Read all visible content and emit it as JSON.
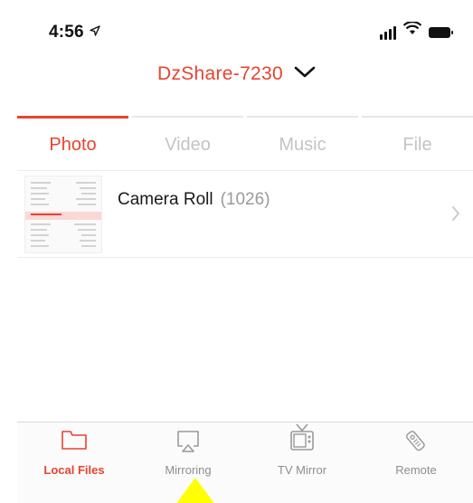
{
  "status_bar": {
    "time": "4:56"
  },
  "header": {
    "title": "DzShare-7230"
  },
  "tabs": [
    {
      "label": "Photo",
      "active": true
    },
    {
      "label": "Video",
      "active": false
    },
    {
      "label": "Music",
      "active": false
    },
    {
      "label": "File",
      "active": false
    }
  ],
  "albums": [
    {
      "name": "Camera Roll",
      "count": "(1026)"
    }
  ],
  "tabbar": [
    {
      "label": "Local Files",
      "icon": "folder-icon",
      "active": true
    },
    {
      "label": "Mirroring",
      "icon": "airplay-icon",
      "active": false
    },
    {
      "label": "TV Mirror",
      "icon": "tv-icon",
      "active": false
    },
    {
      "label": "Remote",
      "icon": "remote-icon",
      "active": false
    }
  ],
  "colors": {
    "accent": "#e8432f",
    "inactive": "#c4c4c4",
    "pointer": "#ffff00"
  }
}
